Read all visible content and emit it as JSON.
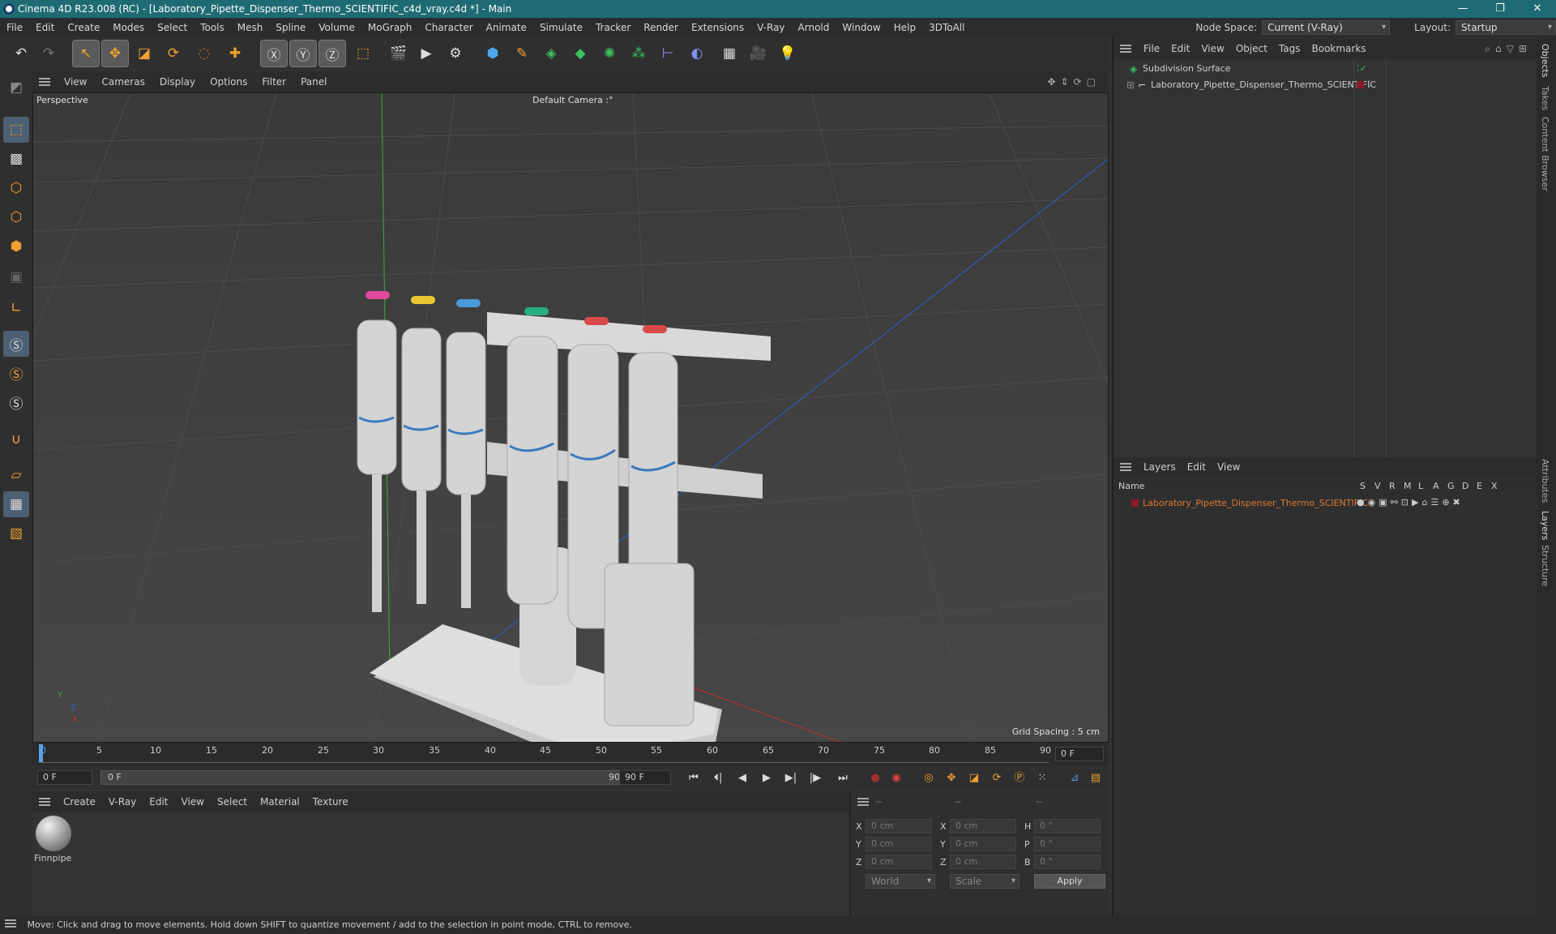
{
  "titlebar": {
    "title": "Cinema 4D R23.008 (RC) - [Laboratory_Pipette_Dispenser_Thermo_SCIENTIFIC_c4d_vray.c4d *] - Main",
    "minimize": "—",
    "restore": "❐",
    "close": "✕"
  },
  "menubar": {
    "items": [
      "File",
      "Edit",
      "Create",
      "Modes",
      "Select",
      "Tools",
      "Mesh",
      "Spline",
      "Volume",
      "MoGraph",
      "Character",
      "Animate",
      "Simulate",
      "Tracker",
      "Render",
      "Extensions",
      "V-Ray",
      "Arnold",
      "Window",
      "Help",
      "3DToAll"
    ]
  },
  "nodespace": {
    "label": "Node Space:",
    "value": "Current (V-Ray)",
    "layout_label": "Layout:",
    "layout_value": "Startup"
  },
  "viewport": {
    "menu": [
      "View",
      "Cameras",
      "Display",
      "Options",
      "Filter",
      "Panel"
    ],
    "name": "Perspective",
    "camera": "Default Camera :°",
    "grid_spacing": "Grid Spacing : 5 cm",
    "axis_y": "Y",
    "axis_z": "Z",
    "axis_x": "X"
  },
  "timeline": {
    "ticks": [
      "0",
      "5",
      "10",
      "15",
      "20",
      "25",
      "30",
      "35",
      "40",
      "45",
      "50",
      "55",
      "60",
      "65",
      "70",
      "75",
      "80",
      "85",
      "90"
    ],
    "current_frame": "0 F"
  },
  "transport": {
    "start": "0 F",
    "range_start": "0 F",
    "range_end": "90 F",
    "end": "90 F"
  },
  "materials": {
    "menu": [
      "Create",
      "V-Ray",
      "Edit",
      "View",
      "Select",
      "Material",
      "Texture"
    ],
    "items": [
      {
        "name": "Finnpipe"
      }
    ]
  },
  "coords": {
    "headers": [
      "--",
      "--",
      "--"
    ],
    "rows": [
      {
        "a": "X",
        "av": "0 cm",
        "b": "X",
        "bv": "0 cm",
        "c": "H",
        "cv": "0 °"
      },
      {
        "a": "Y",
        "av": "0 cm",
        "b": "Y",
        "bv": "0 cm",
        "c": "P",
        "cv": "0 °"
      },
      {
        "a": "Z",
        "av": "0 cm",
        "b": "Z",
        "bv": "0 cm",
        "c": "B",
        "cv": "0 °"
      }
    ],
    "world": "World",
    "scale": "Scale",
    "apply": "Apply"
  },
  "objects": {
    "menu": [
      "File",
      "Edit",
      "View",
      "Object",
      "Tags",
      "Bookmarks"
    ],
    "items": [
      {
        "name": "Subdivision Surface"
      },
      {
        "name": "Laboratory_Pipette_Dispenser_Thermo_SCIENTIFIC"
      }
    ]
  },
  "layers": {
    "menu": [
      "Layers",
      "Edit",
      "View"
    ],
    "col_name": "Name",
    "cols": [
      "S",
      "V",
      "R",
      "M",
      "L",
      "A",
      "G",
      "D",
      "E",
      "X"
    ],
    "item": "Laboratory_Pipette_Dispenser_Thermo_SCIENTIFIC",
    "item_color": "#e07a2e"
  },
  "sidetabs": [
    "Objects",
    "Takes",
    "Content Browser",
    "Attributes",
    "Layers",
    "Structure"
  ],
  "status": "Move: Click and drag to move elements. Hold down SHIFT to quantize movement / add to the selection in point mode, CTRL to remove.",
  "colors": {
    "accent_orange": "#f0a030",
    "title_teal": "#1f6b73",
    "x_red": "#c23030",
    "y_green": "#3caa3c",
    "z_blue": "#3060c8"
  },
  "toolbar_icons": [
    "undo-icon",
    "redo-icon",
    "select-icon",
    "move-icon",
    "scale-icon",
    "rotate-icon",
    "live-select-icon",
    "create-icon",
    "x-axis-icon",
    "y-axis-icon",
    "z-axis-icon",
    "coordinate-icon",
    "render-view-icon",
    "render-icon",
    "render-settings-icon",
    "cube-icon",
    "pen-icon",
    "subdivision-icon",
    "extrude-icon",
    "array-icon",
    "cloner-icon",
    "symmetry-icon",
    "deformer-icon",
    "floor-icon",
    "camera-icon",
    "light-icon"
  ]
}
